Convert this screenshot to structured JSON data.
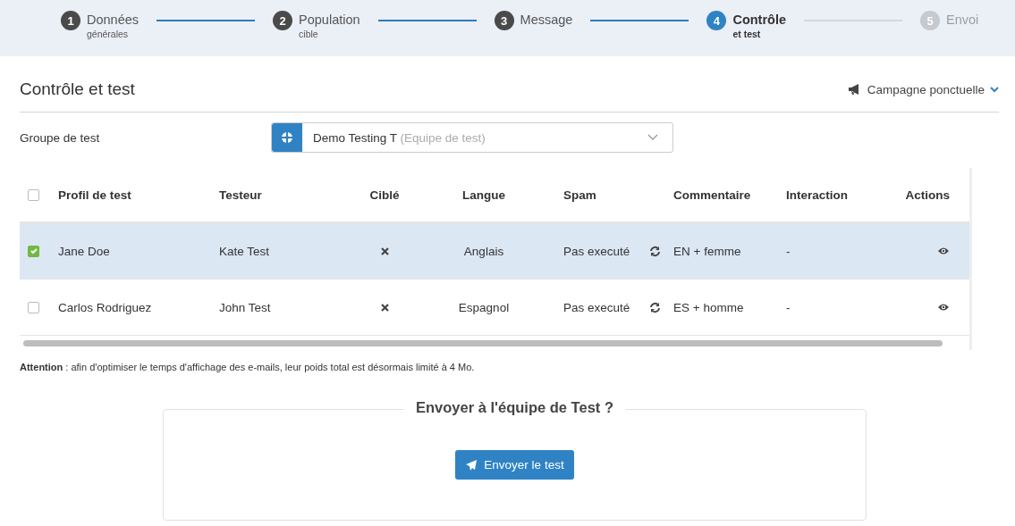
{
  "steps": [
    {
      "number": "1",
      "label": "Données",
      "sublabel": "générales",
      "current": false,
      "disabled": false
    },
    {
      "number": "2",
      "label": "Population",
      "sublabel": "cible",
      "current": false,
      "disabled": false
    },
    {
      "number": "3",
      "label": "Message",
      "current": false,
      "disabled": false
    },
    {
      "number": "4",
      "label": "Contrôle",
      "sublabel": "et test",
      "current": true,
      "disabled": false
    },
    {
      "number": "5",
      "label": "Envoi",
      "current": false,
      "disabled": true
    }
  ],
  "page_title": "Contrôle et test",
  "campaign_menu": "Campagne ponctuelle",
  "test_group": {
    "label": "Groupe de test",
    "value": "Demo Testing T",
    "hint": "(Equipe de test)"
  },
  "table": {
    "select_all_checked": false,
    "columns": [
      "Profil de test",
      "Testeur",
      "Ciblé",
      "Langue",
      "Spam",
      "Commentaire",
      "Interaction",
      "Actions"
    ],
    "rows": [
      {
        "selected": true,
        "profile": "Jane Doe",
        "tester": "Kate Test",
        "language": "Anglais",
        "spam": "Pas executé",
        "comment": "EN + femme",
        "interaction": "-"
      },
      {
        "selected": false,
        "profile": "Carlos Rodriguez",
        "tester": "John Test",
        "language": "Espagnol",
        "spam": "Pas executé",
        "comment": "ES + homme",
        "interaction": "-"
      }
    ]
  },
  "notice": "**Attention** : afin d'optimiser le temps d'affichage des e-mails, leur poids total est désormais limité à 4 Mo.",
  "send_panel": {
    "title": "Envoyer à l'équipe de Test ?",
    "button": "Envoyer le test"
  }
}
